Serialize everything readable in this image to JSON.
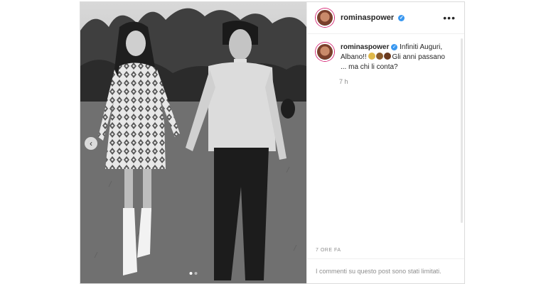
{
  "post": {
    "username": "rominaspower",
    "more_label": "•••",
    "caption_username": "rominaspower",
    "caption_line1": "Infiniti Auguri,",
    "caption_line2": "Albano!!",
    "caption_line3": "Gli anni passano",
    "caption_line4": "... ma chi li conta?",
    "caption_time": "7 h",
    "timestamp": "7 ORE FA",
    "comments_limited": "I commenti su questo post sono stati limitati.",
    "carousel_prev_icon": "chevron-left-icon",
    "carousel_dots": 2,
    "carousel_active": 0
  },
  "colors": {
    "verified": "#3897f0",
    "muted": "#8e8e8e",
    "text": "#262626"
  }
}
